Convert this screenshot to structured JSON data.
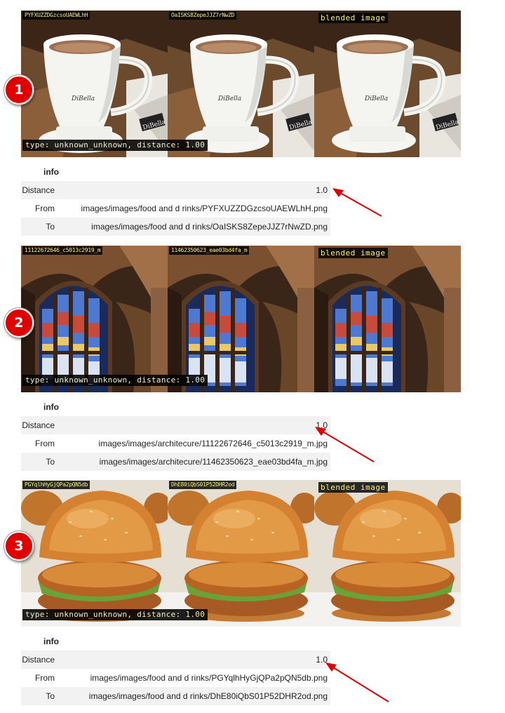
{
  "pairs": [
    {
      "badge": "1",
      "caption_a": "PYFXUZZDGzcsoUAEWLhH",
      "caption_b": "OaISKS8ZepeJJZ7rNwZD",
      "caption_c": "blended image",
      "type_text": "type: unknown_unknown, distance: 1.00",
      "info": {
        "header": "info",
        "distance_label": "Distance",
        "distance_value": "1.0",
        "from_label": "From",
        "from_value": "images/images/food and d rinks/PYFXUZZDGzcsoUAEWLhH.png",
        "to_label": "To",
        "to_value": "images/images/food and d rinks/OaISKS8ZepeJJZ7rNwZD.png"
      }
    },
    {
      "badge": "2",
      "caption_a": "11122672646_c5013c2919_m",
      "caption_b": "11462350623_eae03bd4fa_m",
      "caption_c": "blended image",
      "type_text": "type: unknown_unknown, distance: 1.00",
      "info": {
        "header": "info",
        "distance_label": "Distance",
        "distance_value": "1.0",
        "from_label": "From",
        "from_value": "images/images/architecure/11122672646_c5013c2919_m.jpg",
        "to_label": "To",
        "to_value": "images/images/architecure/11462350623_eae03bd4fa_m.jpg"
      }
    },
    {
      "badge": "3",
      "caption_a": "PGYqlhHyGjQPa2pQN5db",
      "caption_b": "DhE80iQbS01P52DHR2od",
      "caption_c": "blended image",
      "type_text": "type: unknown_unknown, distance: 1.00",
      "info": {
        "header": "info",
        "distance_label": "Distance",
        "distance_value": "1.0",
        "from_label": "From",
        "from_value": "images/images/food and d rinks/PGYqlhHyGjQPa2pQN5db.png",
        "to_label": "To",
        "to_value": "images/images/food and d rinks/DhE80iQbS01P52DHR2od.png"
      }
    }
  ],
  "colors": {
    "badge": "#e00000",
    "arrow": "#e00000",
    "caption_text": "#f4f07a",
    "row_alt": "#f2f2f2"
  },
  "icons": {
    "photo_1": "coffee-cup-photo",
    "photo_2": "cathedral-window-photo",
    "photo_3": "chicken-burger-photo",
    "annotation": "red-arrow-icon"
  }
}
